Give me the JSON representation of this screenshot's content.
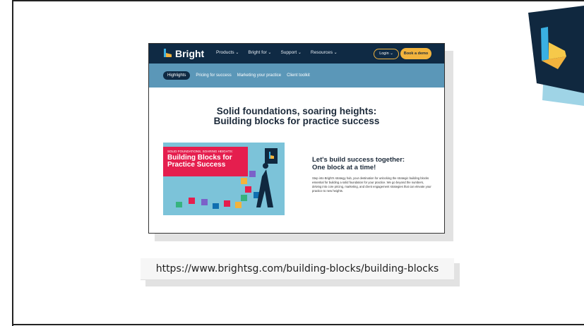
{
  "colors": {
    "navy": "#0f2a44",
    "teal": "#5b97b8",
    "amber": "#f2b33d",
    "red": "#e51e4e",
    "sky": "#7cc3d9"
  },
  "site": {
    "brand": "Bright",
    "nav": [
      "Products",
      "Bright for",
      "Support",
      "Resources"
    ],
    "login": "Login",
    "demo": "Book a demo",
    "subnav": [
      "Highlights",
      "Pricing for success",
      "Marketing your practice",
      "Client toolkit"
    ],
    "headline1": "Solid foundations, soaring heights:",
    "headline2": "Building blocks for practice success",
    "banner_small": "SOLID FOUNDATIONS, SOARING HEIGHTS:",
    "banner_title1": "Building Blocks for",
    "banner_title2": "Practice Success",
    "tagline1": "Let's build success together:",
    "tagline2": "One block at a time!",
    "body": "Step into Bright's strategy hub, your destination for unlocking the strategic building blocks essential for building a solid foundation for your practice. We go beyond the numbers, delving into core pricing, marketing, and client engagement strategies that can elevate your practice to new heights."
  },
  "url": "https://www.brightsg.com/building-blocks/building-blocks"
}
